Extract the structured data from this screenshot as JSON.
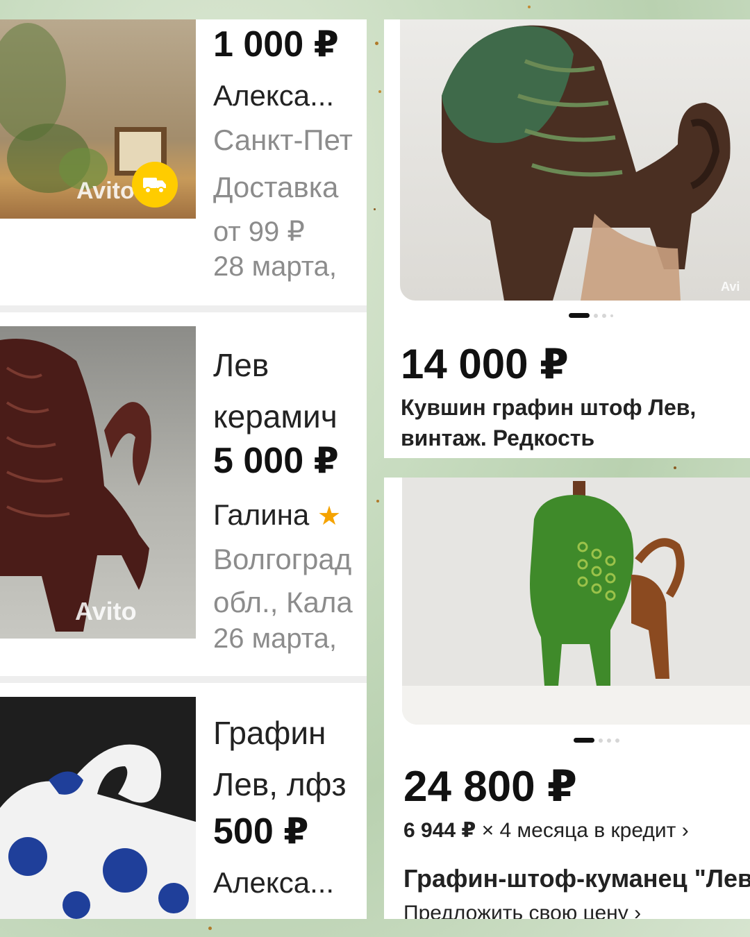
{
  "colors": {
    "accent_star": "#f5a300",
    "delivery_badge": "#ffcc00",
    "price_text": "#111111",
    "secondary_text": "#8c8c8c"
  },
  "left_list": {
    "items": [
      {
        "price": "1 000 ₽",
        "seller": "Алекса...",
        "location": "Санкт-Пет",
        "delivery": "Доставка",
        "delivery_price": "от 99 ₽",
        "date": "28 марта,",
        "watermark": "Avito",
        "badge_icon": "truck-icon"
      },
      {
        "title_line1": "Лев",
        "title_line2": "керамич",
        "price": "5 000 ₽",
        "seller": "Галина",
        "rating_icon": "star-icon",
        "location_line1": "Волгоград",
        "location_line2": "обл., Кала",
        "date": "26 марта,",
        "watermark": "Avito"
      },
      {
        "title_line1": "Графин",
        "title_line2": "Лев, лфз",
        "price": "500 ₽",
        "seller": "Алекса..."
      }
    ]
  },
  "right_top": {
    "watermark": "Avi",
    "price": "14 000 ₽",
    "title_line1": "Кувшин графин штоф Лев,",
    "title_line2": "винтаж. Редкость",
    "carousel": {
      "pages": 5,
      "active": 1
    }
  },
  "right_bottom": {
    "price": "24 800 ₽",
    "credit_amount": "6 944 ₽",
    "credit_text": "× 4 месяца в кредит",
    "credit_chevron": "›",
    "title": "Графин-штоф-куманец \"Лев\"",
    "offer_price": "Предложить свою цену",
    "offer_chevron": "›",
    "carousel": {
      "pages": 4,
      "active": 1
    }
  }
}
